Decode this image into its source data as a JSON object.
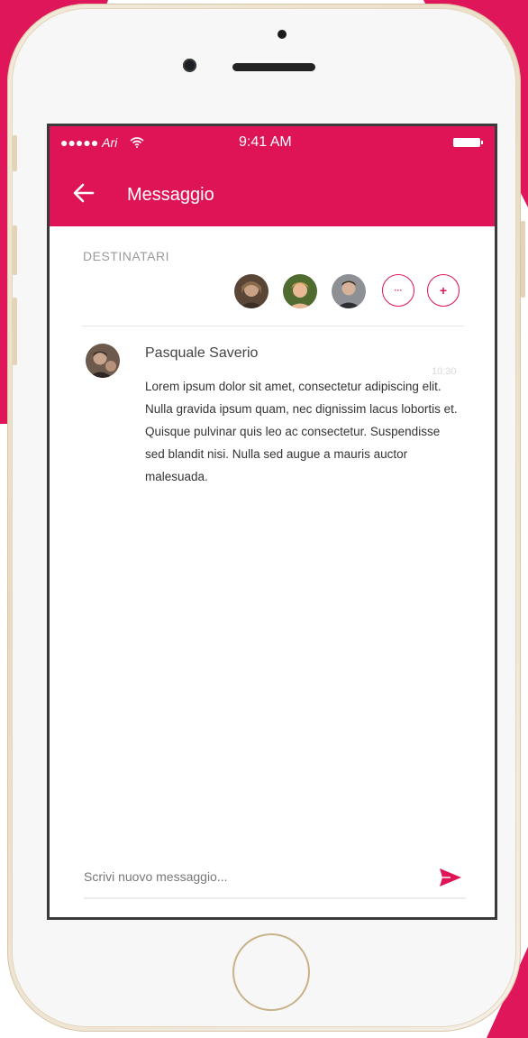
{
  "status_bar": {
    "carrier": "●●●●● ",
    "time": "9:41 AM"
  },
  "app_bar": {
    "title": "Messaggio"
  },
  "recipients": {
    "label": "DESTINATARI",
    "avatars": [
      "avatar-1",
      "avatar-2",
      "avatar-3"
    ],
    "more_label": "···",
    "add_label": "+"
  },
  "message": {
    "sender": "Pasquale Saverio",
    "time": "10:30",
    "body": "Lorem ipsum dolor sit amet, consectetur adipiscing elit. Nulla gravida ipsum quam, nec dignissim lacus lobortis et. Quisque pulvinar quis leo ac consectetur. Suspendisse sed blandit nisi. Nulla sed augue a mauris auctor malesuada."
  },
  "composer": {
    "placeholder": "Scrivi nuovo messaggio..."
  },
  "colors": {
    "accent": "#de1457"
  }
}
